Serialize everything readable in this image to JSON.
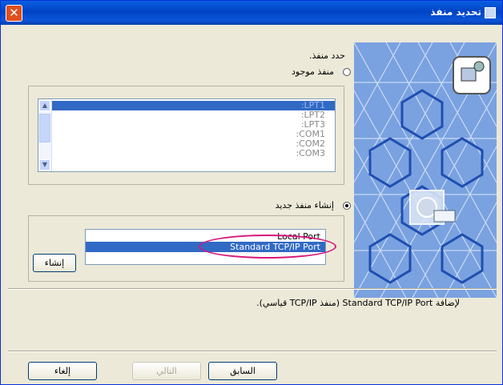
{
  "window": {
    "title": "تحديد منفذ",
    "close_label": "✕"
  },
  "prompt": "حدد منفذ.",
  "existing_port": {
    "label": "منفذ موجود",
    "selected": false
  },
  "ports": [
    ":LPT1",
    ":LPT2",
    ":LPT3",
    ":COM1",
    ":COM2",
    ":COM3"
  ],
  "new_port": {
    "label": "إنشاء منفذ جديد",
    "selected": true
  },
  "port_types": [
    "Local Port",
    "Standard TCP/IP Port"
  ],
  "selected_port_type": "Standard TCP/IP Port",
  "create_button": "إنشاء",
  "description": "لإضافة Standard TCP/IP Port (منفذ TCP/IP قياسي).",
  "buttons": {
    "back": "السابق",
    "next": "التالي",
    "cancel": "إلغاء"
  },
  "colors": {
    "title_bar": "#0a5fe0",
    "selection": "#316ac5",
    "highlight_ellipse": "#d6187c",
    "dialog_bg": "#ece9d8"
  }
}
